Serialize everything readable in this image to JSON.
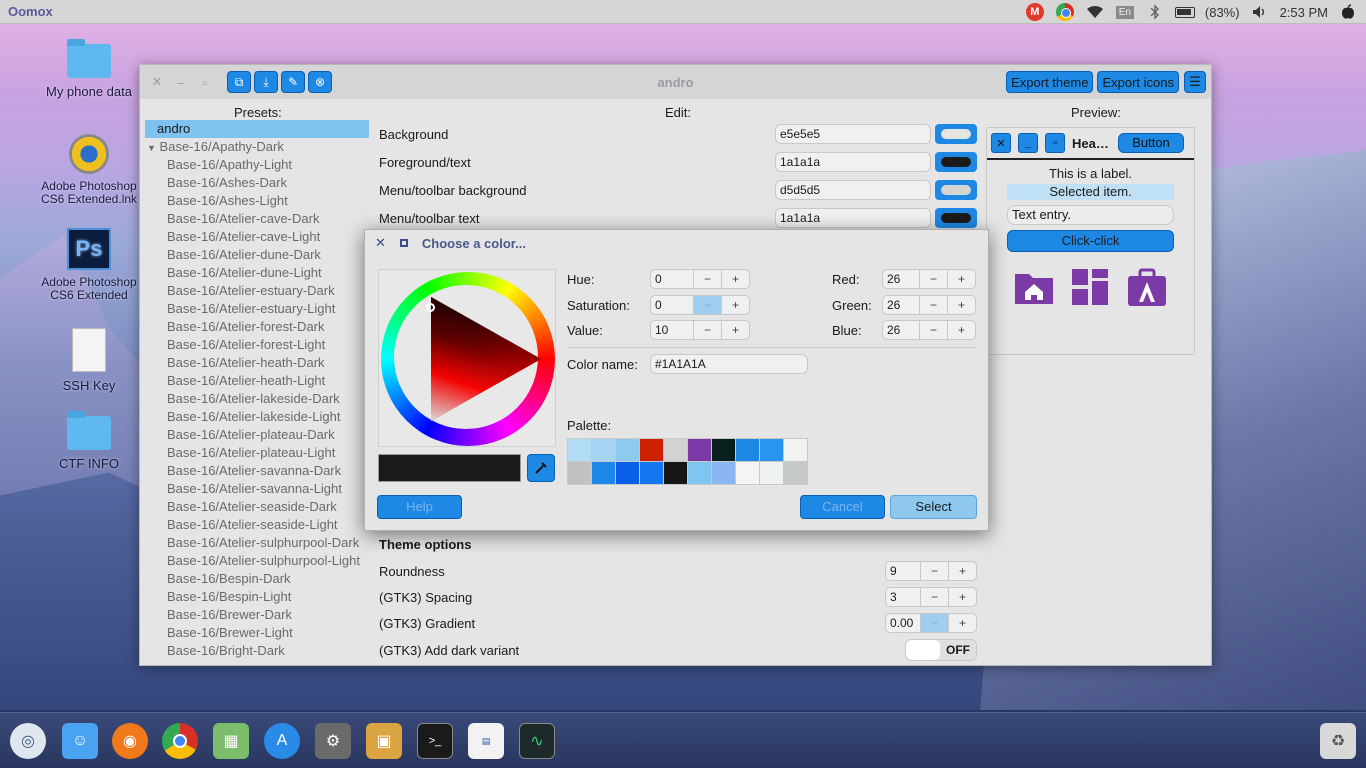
{
  "topbar": {
    "app_title": "Oomox",
    "gmail_icon_letter": "M",
    "keyboard_layout": "En",
    "battery": "(83%)",
    "clock": "2:53 PM"
  },
  "desktop_icons": [
    {
      "label": "My phone data",
      "icon": "folder-icon"
    },
    {
      "label": "Adobe Photoshop CS6 Extended.lnk",
      "icon": "photoshop-shortcut-icon"
    },
    {
      "label": "Adobe Photoshop CS6 Extended",
      "icon": "photoshop-icon",
      "glyph": "Ps"
    },
    {
      "label": "SSH Key",
      "icon": "file-icon"
    },
    {
      "label": "CTF INFO",
      "icon": "folder-icon"
    }
  ],
  "window": {
    "title": "andro",
    "export_theme": "Export theme",
    "export_icons": "Export icons",
    "presets_header": "Presets:",
    "edit_header": "Edit:",
    "preview_header": "Preview:"
  },
  "presets": {
    "selected": "andro",
    "group": "Base-16/Apathy-Dark",
    "items": [
      "Base-16/Apathy-Light",
      "Base-16/Ashes-Dark",
      "Base-16/Ashes-Light",
      "Base-16/Atelier-cave-Dark",
      "Base-16/Atelier-cave-Light",
      "Base-16/Atelier-dune-Dark",
      "Base-16/Atelier-dune-Light",
      "Base-16/Atelier-estuary-Dark",
      "Base-16/Atelier-estuary-Light",
      "Base-16/Atelier-forest-Dark",
      "Base-16/Atelier-forest-Light",
      "Base-16/Atelier-heath-Dark",
      "Base-16/Atelier-heath-Light",
      "Base-16/Atelier-lakeside-Dark",
      "Base-16/Atelier-lakeside-Light",
      "Base-16/Atelier-plateau-Dark",
      "Base-16/Atelier-plateau-Light",
      "Base-16/Atelier-savanna-Dark",
      "Base-16/Atelier-savanna-Light",
      "Base-16/Atelier-seaside-Dark",
      "Base-16/Atelier-seaside-Light",
      "Base-16/Atelier-sulphurpool-Dark",
      "Base-16/Atelier-sulphurpool-Light",
      "Base-16/Bespin-Dark",
      "Base-16/Bespin-Light",
      "Base-16/Brewer-Dark",
      "Base-16/Brewer-Light",
      "Base-16/Bright-Dark"
    ]
  },
  "edit": {
    "colors": [
      {
        "label": "Background",
        "value": "e5e5e5",
        "swatch": "#e5e5e5"
      },
      {
        "label": "Foreground/text",
        "value": "1a1a1a",
        "swatch": "#1a1a1a"
      },
      {
        "label": "Menu/toolbar background",
        "value": "d5d5d5",
        "swatch": "#d5d5d5"
      },
      {
        "label": "Menu/toolbar text",
        "value": "1a1a1a",
        "swatch": "#1a1a1a"
      }
    ],
    "theme_options_header": "Theme options",
    "roundness_label": "Roundness",
    "roundness_value": "9",
    "spacing_label": "(GTK3) Spacing",
    "spacing_value": "3",
    "gradient_label": "(GTK3) Gradient",
    "gradient_value": "0.00",
    "dark_variant_label": "(GTK3) Add dark variant",
    "dark_variant_state": "OFF"
  },
  "preview": {
    "header_title": "Hea…",
    "button_label": "Button",
    "label_text": "This is a label.",
    "selected_item": "Selected item.",
    "text_entry": "Text entry.",
    "click_button": "Click-click",
    "icons": [
      "home-folder-icon",
      "apps-grid-icon",
      "toolbox-icon"
    ],
    "icon_color": "#7b3aa6"
  },
  "dialog": {
    "title": "Choose a color...",
    "hue_label": "Hue:",
    "hue": "0",
    "saturation_label": "Saturation:",
    "saturation": "0",
    "value_label": "Value:",
    "value": "10",
    "red_label": "Red:",
    "red": "26",
    "green_label": "Green:",
    "green": "26",
    "blue_label": "Blue:",
    "blue": "26",
    "color_name_label": "Color name:",
    "color_name": "#1A1A1A",
    "palette_label": "Palette:",
    "palette": [
      "#b3dcf7",
      "#a5d3f2",
      "#8ccaef",
      "#cc2200",
      "#d2d2d2",
      "#7b3aa6",
      "#07201e",
      "#1e88e5",
      "#2a95ef",
      "#f2f2f2",
      "#c2c2c2",
      "#1b87e8",
      "#0a5fe8",
      "#1477f0",
      "#161616",
      "#7ec6ef",
      "#8ab6f2",
      "#f4f4f4",
      "#eef2f2",
      "#c4c8c8"
    ],
    "current_color": "#1a1a1a",
    "help": "Help",
    "cancel": "Cancel",
    "select": "Select"
  }
}
